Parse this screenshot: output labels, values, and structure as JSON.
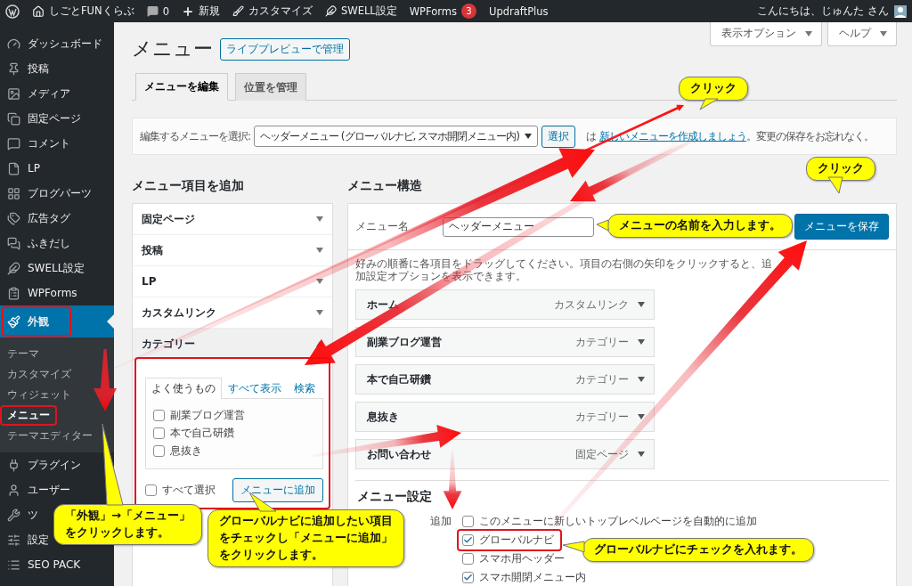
{
  "admin_bar": {
    "items": [
      {
        "kind": "logo"
      },
      {
        "kind": "home",
        "label": "しごとFUNくらぶ"
      },
      {
        "kind": "comments",
        "label": "0"
      },
      {
        "kind": "new",
        "label": "新規"
      },
      {
        "kind": "brush",
        "label": "カスタマイズ"
      },
      {
        "kind": "swell",
        "label": "SWELL設定"
      },
      {
        "kind": "plain",
        "label": "WPForms",
        "badge": "3"
      },
      {
        "kind": "plain",
        "label": "UpdraftPlus"
      }
    ],
    "greeting": "こんにちは、じゅんた さん"
  },
  "sidebar": {
    "items": [
      {
        "kind": "dashboard",
        "label": "ダッシュボード",
        "selected": false,
        "highlighted": false
      },
      {
        "kind": "pin",
        "label": "投稿",
        "selected": false,
        "highlighted": false
      },
      {
        "kind": "media",
        "label": "メディア",
        "selected": false,
        "highlighted": false
      },
      {
        "kind": "pages",
        "label": "固定ページ",
        "selected": false,
        "highlighted": false
      },
      {
        "kind": "comment",
        "label": "コメント",
        "selected": false,
        "highlighted": false
      },
      {
        "kind": "file",
        "label": "LP",
        "selected": false,
        "highlighted": false
      },
      {
        "kind": "grid",
        "label": "ブログパーツ",
        "selected": false,
        "highlighted": false
      },
      {
        "kind": "tags",
        "label": "広告タグ",
        "selected": false,
        "highlighted": false
      },
      {
        "kind": "bubbles",
        "label": "ふきだし",
        "selected": false,
        "highlighted": false
      },
      {
        "kind": "swell",
        "label": "SWELL設定",
        "selected": false,
        "highlighted": false
      },
      {
        "kind": "form",
        "label": "WPForms",
        "selected": false,
        "highlighted": false
      },
      {
        "kind": "brush",
        "label": "外観",
        "selected": true,
        "highlighted": true,
        "children": [
          {
            "label": "テーマ",
            "selected": false,
            "highlighted": false
          },
          {
            "label": "カスタマイズ",
            "selected": false,
            "highlighted": false
          },
          {
            "label": "ウィジェット",
            "selected": false,
            "highlighted": false
          },
          {
            "label": "メニュー",
            "selected": true,
            "highlighted": true
          },
          {
            "label": "テーマエディター",
            "selected": false,
            "highlighted": false
          }
        ]
      },
      {
        "kind": "plug",
        "label": "プラグイン",
        "selected": false,
        "highlighted": false
      },
      {
        "kind": "user",
        "label": "ユーザー",
        "selected": false,
        "highlighted": false
      },
      {
        "kind": "wrench",
        "label": "ツ",
        "selected": false,
        "highlighted": false
      },
      {
        "kind": "sliders",
        "label": "設定",
        "selected": false,
        "highlighted": false
      },
      {
        "kind": "list",
        "label": "SEO PACK",
        "selected": false,
        "highlighted": false
      }
    ]
  },
  "screen_options": [
    "表示オプション",
    "ヘルプ"
  ],
  "page_title": "メニュー",
  "live_preview_button": "ライブプレビューで管理",
  "tabs": [
    {
      "label": "メニューを編集",
      "selected": true
    },
    {
      "label": "位置を管理",
      "selected": false
    }
  ],
  "select_bar": {
    "label": "編集するメニューを選択:",
    "value": "ヘッダーメニュー (グローバルナビ, スマホ開閉メニュー内)",
    "button": "選択",
    "note_prefix": "は",
    "link": "新しいメニューを作成しましょう",
    "note_suffix": "。変更の保存をお忘れなく。"
  },
  "add_items": {
    "heading": "メニュー項目を追加",
    "sections": [
      {
        "label": "固定ページ",
        "expanded": false
      },
      {
        "label": "投稿",
        "expanded": false
      },
      {
        "label": "LP",
        "expanded": false
      },
      {
        "label": "カスタムリンク",
        "expanded": false
      },
      {
        "label": "カテゴリー",
        "expanded": true
      }
    ],
    "category_panel": {
      "highlighted": true,
      "tabs": [
        {
          "label": "よく使うもの",
          "selected": true
        },
        {
          "label": "すべて表示",
          "selected": false
        },
        {
          "label": "検索",
          "selected": false
        }
      ],
      "items": [
        {
          "label": "副業ブログ運営",
          "checked": false
        },
        {
          "label": "本で自己研鑽",
          "checked": false
        },
        {
          "label": "息抜き",
          "checked": false
        }
      ],
      "select_all": {
        "label": "すべて選択",
        "checked": false
      },
      "add_button": "メニューに追加"
    }
  },
  "structure": {
    "heading": "メニュー構造",
    "name_label": "メニュー名",
    "name_value": "ヘッダーメニュー",
    "save_button": "メニューを保存",
    "instructions": "好みの順番に各項目をドラッグしてください。項目の右側の矢印をクリックすると、追加設定オプションを表示できます。",
    "items": [
      {
        "label": "ホーム",
        "type": "カスタムリンク"
      },
      {
        "label": "副業ブログ運営",
        "type": "カテゴリー"
      },
      {
        "label": "本で自己研鑽",
        "type": "カテゴリー"
      },
      {
        "label": "息抜き",
        "type": "カテゴリー"
      },
      {
        "label": "お問い合わせ",
        "type": "固定ページ"
      }
    ],
    "settings": {
      "heading": "メニュー設定",
      "auto_add_label": "追加",
      "auto_add": {
        "label": "このメニューに新しいトップレベルページを自動的に追加",
        "checked": false
      },
      "locations": [
        {
          "label": "グローバルナビ",
          "checked": true,
          "highlighted": true
        },
        {
          "label": "スマホ用ヘッダー",
          "checked": false,
          "highlighted": false
        },
        {
          "label": "スマホ開閉メニュー内",
          "checked": true,
          "highlighted": false
        }
      ]
    }
  },
  "callouts": [
    {
      "lines": [
        "クリック"
      ]
    },
    {
      "lines": [
        "クリック"
      ]
    },
    {
      "lines": [
        "メニューの名前を入力します。"
      ]
    },
    {
      "lines": [
        "「外観」→「メニュー」",
        "をクリックします。"
      ]
    },
    {
      "lines": [
        "グローバルナビに追加したい項目",
        "をチェックし「メニューに追加」",
        "をクリックします。"
      ]
    },
    {
      "lines": [
        "グローバルナビにチェックを入れます。"
      ]
    }
  ]
}
